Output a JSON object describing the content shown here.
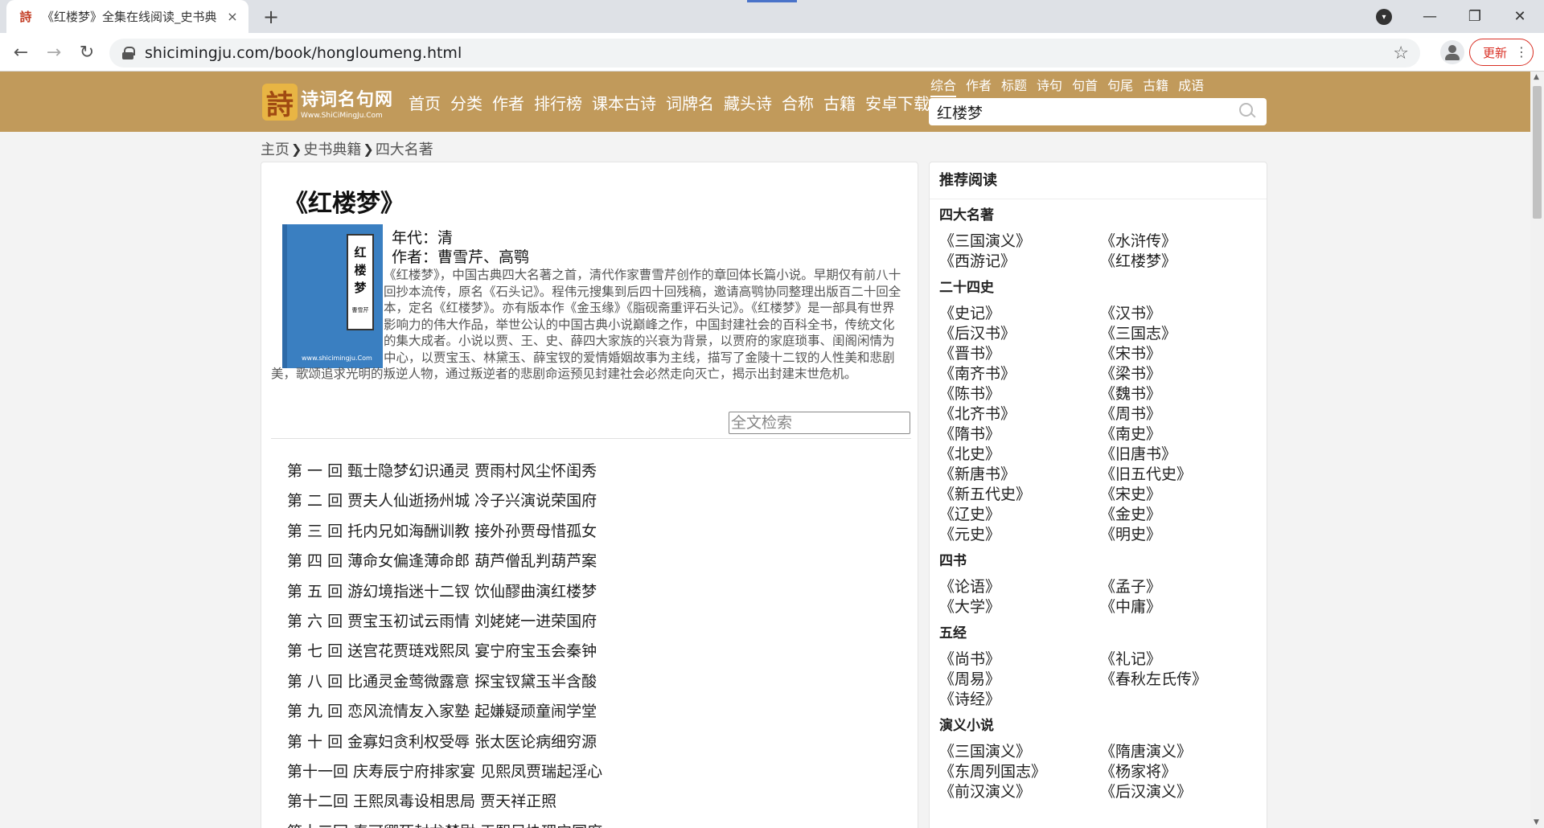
{
  "browser": {
    "tab_title": "《红楼梦》全集在线阅读_史书典",
    "tab_favicon": "詩",
    "url": "shicimingju.com/book/hongloumeng.html",
    "update_label": "更新",
    "icons": {
      "tab_close": "×",
      "new_tab": "+",
      "minimize": "—",
      "maximize": "❐",
      "close": "✕",
      "back": "←",
      "forward": "→",
      "reload": "↻",
      "star": "☆",
      "menu": "⋮",
      "profile_drop": "▾"
    }
  },
  "site": {
    "logo_mark": "詩",
    "logo_name": "诗词名句网",
    "logo_url": "Www.ShiCiMingJu.Com",
    "nav": [
      "首页",
      "分类",
      "作者",
      "排行榜",
      "课本古诗",
      "词牌名",
      "藏头诗",
      "合称",
      "古籍",
      "安卓下载"
    ],
    "search_tabs": [
      "综合",
      "作者",
      "标题",
      "诗句",
      "句首",
      "句尾",
      "古籍",
      "成语"
    ],
    "search_value": "红楼梦"
  },
  "breadcrumb": [
    "主页",
    "史书典籍",
    "四大名著"
  ],
  "breadcrumb_sep": "❯",
  "book": {
    "title": "《红楼梦》",
    "cover_chars": [
      "红",
      "楼",
      "梦"
    ],
    "cover_author": "曹雪芹",
    "cover_url": "www.shicimingju.Com",
    "era": "年代：清",
    "author": "作者：曹雪芹、高鹗",
    "description": "《红楼梦》，中国古典四大名著之首，清代作家曹雪芹创作的章回体长篇小说。早期仅有前八十回抄本流传，原名《石头记》。程伟元搜集到后四十回残稿，邀请高鹗协同整理出版百二十回全本，定名《红楼梦》。亦有版本作《金玉缘》《脂砚斋重评石头记》。《红楼梦》是一部具有世界影响力的伟大作品，举世公认的中国古典小说巅峰之作，中国封建社会的百科全书，传统文化的集大成者。小说以贾、王、史、薛四大家族的兴衰为背景，以贾府的家庭琐事、闺阁闲情为中心，以贾宝玉、林黛玉、薛宝钗的爱情婚姻故事为主线，描写了金陵十二钗的人性美和悲剧美，歌颂追求光明的叛逆人物，通过叛逆者的悲剧命运预见封建社会必然走向灭亡，揭示出封建末世危机。",
    "fulltext_placeholder": "全文检索",
    "chapters": [
      "第 一 回 甄士隐梦幻识通灵 贾雨村风尘怀闺秀",
      "第 二 回 贾夫人仙逝扬州城 冷子兴演说荣国府",
      "第 三 回 托内兄如海酬训教 接外孙贾母惜孤女",
      "第 四 回 薄命女偏逢薄命郎 葫芦僧乱判葫芦案",
      "第 五 回 游幻境指迷十二钗 饮仙醪曲演红楼梦",
      "第 六 回 贾宝玉初试云雨情 刘姥姥一进荣国府",
      "第 七 回 送宫花贾琏戏熙凤 宴宁府宝玉会秦钟",
      "第 八 回 比通灵金莺微露意 探宝钗黛玉半含酸",
      "第 九 回 恋风流情友入家塾 起嫌疑顽童闹学堂",
      "第 十 回 金寡妇贪利权受辱 张太医论病细穷源",
      "第十一回 庆寿辰宁府排家宴 见熙凤贾瑞起淫心",
      "第十二回 王熙凤毒设相思局 贾天祥正照",
      "第十三回 秦可卿死封龙禁尉 王熙凤协理宁国府"
    ]
  },
  "sidebar": {
    "heading": "推荐阅读",
    "sections": [
      {
        "name": "四大名著",
        "items": [
          "《三国演义》",
          "《水浒传》",
          "《西游记》",
          "《红楼梦》"
        ]
      },
      {
        "name": "二十四史",
        "items": [
          "《史记》",
          "《汉书》",
          "《后汉书》",
          "《三国志》",
          "《晋书》",
          "《宋书》",
          "《南齐书》",
          "《梁书》",
          "《陈书》",
          "《魏书》",
          "《北齐书》",
          "《周书》",
          "《隋书》",
          "《南史》",
          "《北史》",
          "《旧唐书》",
          "《新唐书》",
          "《旧五代史》",
          "《新五代史》",
          "《宋史》",
          "《辽史》",
          "《金史》",
          "《元史》",
          "《明史》"
        ]
      },
      {
        "name": "四书",
        "items": [
          "《论语》",
          "《孟子》",
          "《大学》",
          "《中庸》"
        ]
      },
      {
        "name": "五经",
        "items": [
          "《尚书》",
          "《礼记》",
          "《周易》",
          "《春秋左氏传》",
          "《诗经》"
        ]
      },
      {
        "name": "演义小说",
        "items": [
          "《三国演义》",
          "《隋唐演义》",
          "《东周列国志》",
          "《杨家将》",
          "《前汉演义》",
          "《后汉演义》"
        ]
      }
    ]
  }
}
